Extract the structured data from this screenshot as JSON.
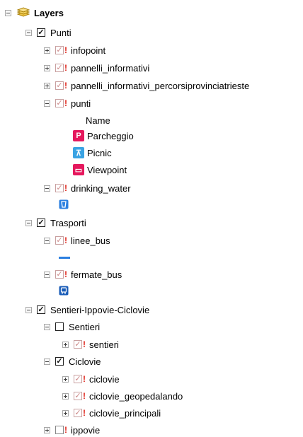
{
  "tree": {
    "root": {
      "label": "Layers",
      "icon": "layers-stack-icon",
      "expanded": true
    },
    "punti_group": {
      "label": "Punti",
      "checked": true,
      "expanded": true
    },
    "infopoint": {
      "label": "infopoint",
      "checked": true,
      "expanded": false
    },
    "pannelli_informativi": {
      "label": "pannelli_informativi",
      "checked": true,
      "expanded": false
    },
    "pannelli_percorsi": {
      "label": "pannelli_informativi_percorsiprovinciatrieste",
      "checked": true,
      "expanded": false
    },
    "punti_layer": {
      "label": "punti",
      "checked": true,
      "expanded": true,
      "legend_header": "Name",
      "legend": [
        {
          "label": "Parcheggio",
          "icon": "parking-icon",
          "glyph": "P",
          "color": "#e5185d"
        },
        {
          "label": "Picnic",
          "icon": "picnic-table-icon",
          "glyph": "⊼",
          "color": "#3aa3e3"
        },
        {
          "label": "Viewpoint",
          "icon": "viewpoint-icon",
          "glyph": "▭",
          "color": "#e5185d"
        }
      ]
    },
    "drinking_water": {
      "label": "drinking_water",
      "checked": true,
      "expanded": true,
      "symbol_icon": "drinking-water-icon",
      "symbol_color": "#2b7fe0"
    },
    "trasporti_group": {
      "label": "Trasporti",
      "checked": true,
      "expanded": true
    },
    "linee_bus": {
      "label": "linee_bus",
      "checked": true,
      "expanded": true,
      "symbol_icon": "bus-line-icon",
      "symbol_color": "#2b7fe0"
    },
    "fermate_bus": {
      "label": "fermate_bus",
      "checked": true,
      "expanded": true,
      "symbol_icon": "bus-stop-icon",
      "symbol_color": "#1b5db8"
    },
    "sentieri_group": {
      "label": "Sentieri-Ippovie-Ciclovie",
      "checked": true,
      "expanded": true
    },
    "sentieri_subgroup": {
      "label": "Sentieri",
      "checked": false,
      "expanded": true
    },
    "sentieri_layer": {
      "label": "sentieri",
      "checked": true,
      "expanded": false
    },
    "ciclovie_subgroup": {
      "label": "Ciclovie",
      "checked": true,
      "expanded": true
    },
    "ciclovie": {
      "label": "ciclovie",
      "checked": true,
      "expanded": false
    },
    "ciclovie_geopedalando": {
      "label": "ciclovie_geopedalando",
      "checked": true,
      "expanded": false
    },
    "ciclovie_principali": {
      "label": "ciclovie_principali",
      "checked": true,
      "expanded": false
    },
    "ippovie": {
      "label": "ippovie",
      "checked": false,
      "expanded": false
    }
  }
}
